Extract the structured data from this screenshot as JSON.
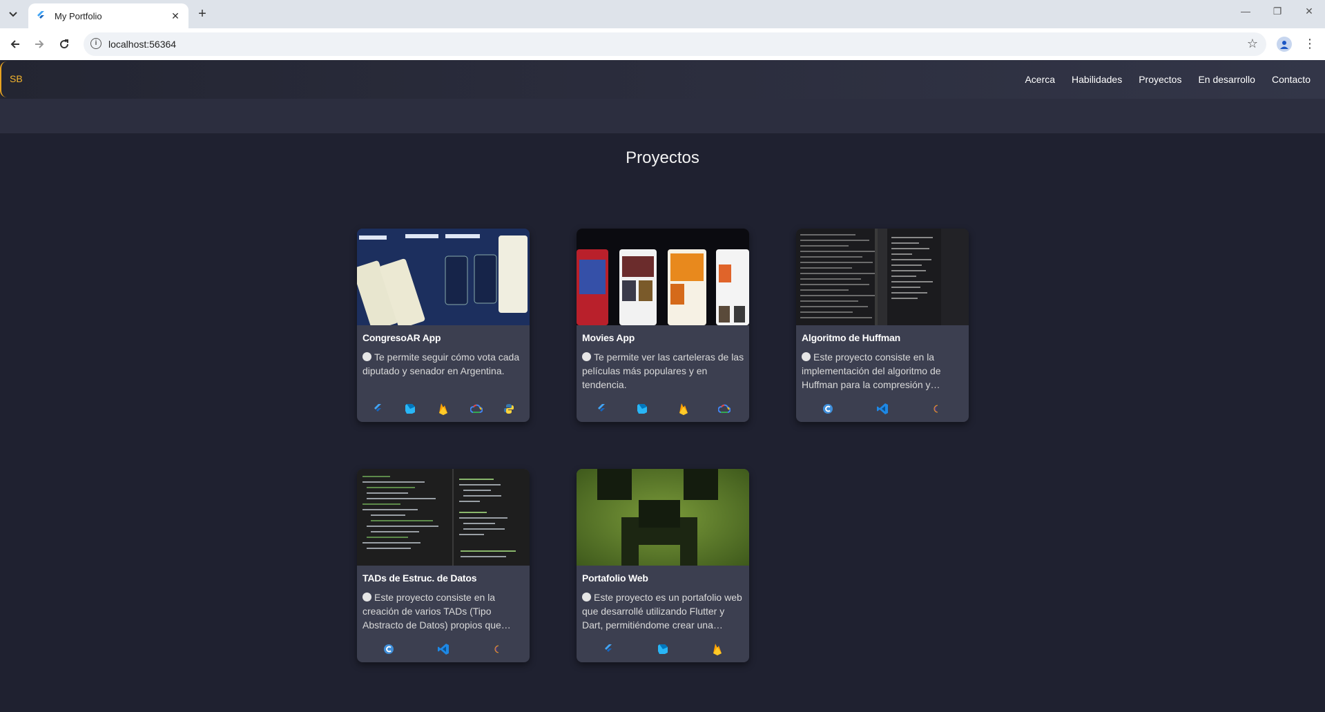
{
  "browser": {
    "tab_title": "My Portfolio",
    "url": "localhost:56364"
  },
  "nav": {
    "logo": "SB",
    "items": [
      "Acerca",
      "Habilidades",
      "Proyectos",
      "En desarrollo",
      "Contacto"
    ]
  },
  "projects": {
    "title": "Proyectos",
    "cards": [
      {
        "name": "CongresoAR App",
        "description": "Te permite seguir cómo vota cada diputado y senador en Argentina.",
        "tech": [
          "flutter-icon",
          "dart-icon",
          "firebase-icon",
          "google-cloud-icon",
          "python-icon"
        ]
      },
      {
        "name": "Movies App",
        "description": "Te permite ver las carteleras de las películas más populares y en tendencia.",
        "tech": [
          "flutter-icon",
          "dart-icon",
          "firebase-icon",
          "google-cloud-icon"
        ]
      },
      {
        "name": "Algoritmo de Huffman",
        "description": "Este proyecto consiste en la implementación del algoritmo de Huffman para la compresión y descompresión de archivos.",
        "tech": [
          "c-icon",
          "vscode-icon",
          "eclipse-icon"
        ]
      },
      {
        "name": "TADs de Estruc. de Datos",
        "description": "Este proyecto consiste en la creación de varios TADs (Tipo Abstracto de Datos) propios que implementan estructuras de datos.",
        "tech": [
          "c-icon",
          "vscode-icon",
          "eclipse-icon"
        ]
      },
      {
        "name": "Portafolio Web",
        "description": "Este proyecto es un portafolio web que desarrollé utilizando Flutter y Dart, permitiéndome crear una experiencia interactiva.",
        "tech": [
          "flutter-icon",
          "dart-icon",
          "firebase-icon"
        ]
      }
    ]
  },
  "colors": {
    "accent": "#f5b52d",
    "background": "#1f2130",
    "card": "#3c3f50"
  }
}
